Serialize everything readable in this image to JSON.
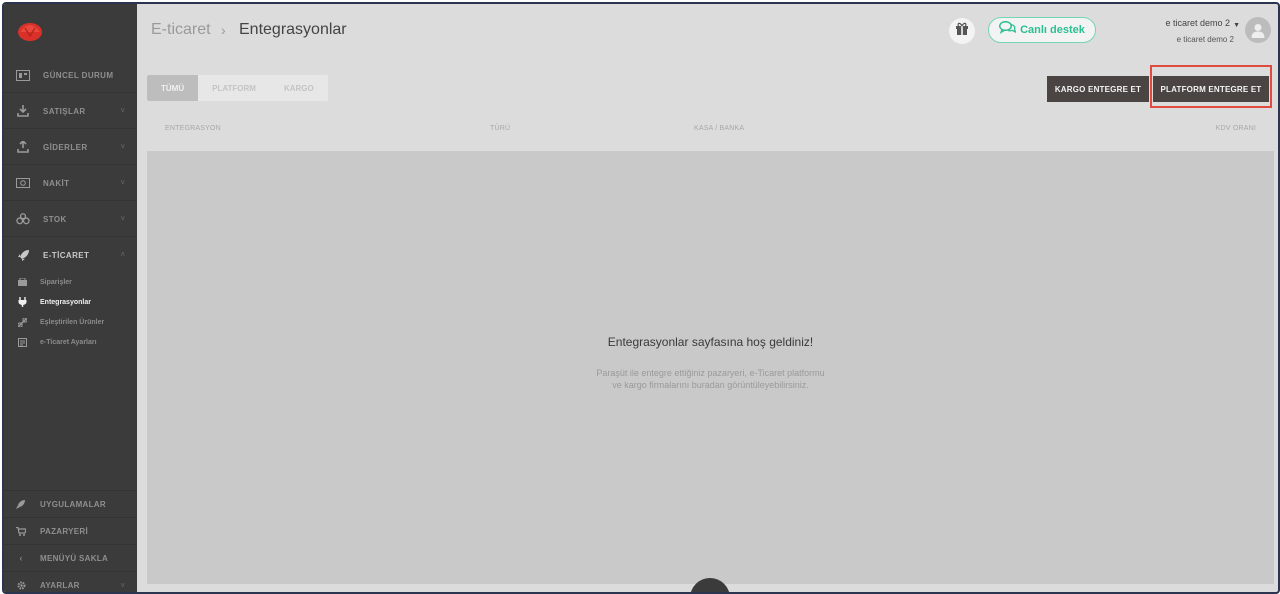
{
  "sidebar": {
    "items": [
      {
        "label": "GÜNCEL DURUM",
        "icon": "dashboard-icon"
      },
      {
        "label": "SATIŞLAR",
        "icon": "download-icon"
      },
      {
        "label": "GİDERLER",
        "icon": "upload-icon"
      },
      {
        "label": "NAKİT",
        "icon": "cash-icon"
      },
      {
        "label": "STOK",
        "icon": "boxes-icon"
      },
      {
        "label": "E-TİCARET",
        "icon": "rocket-icon"
      }
    ],
    "sub_items": [
      {
        "label": "Siparişler",
        "icon": "order-icon"
      },
      {
        "label": "Entegrasyonlar",
        "icon": "plug-icon"
      },
      {
        "label": "Eşleştirilen Ürünler",
        "icon": "link-icon"
      },
      {
        "label": "e-Ticaret Ayarları",
        "icon": "settings-list-icon"
      }
    ],
    "bottom_items": [
      {
        "label": "UYGULAMALAR",
        "icon": "apps-icon"
      },
      {
        "label": "PAZARYERİ",
        "icon": "cart-icon"
      },
      {
        "label": "MENÜYÜ SAKLA",
        "icon": "collapse-icon"
      },
      {
        "label": "AYARLAR",
        "icon": "gear-icon"
      }
    ]
  },
  "header": {
    "breadcrumb_root": "E-ticaret",
    "breadcrumb_sep": "›",
    "page_title": "Entegrasyonlar",
    "support_label": "Canlı destek",
    "user_name": "e ticaret demo 2",
    "user_company": "e ticaret demo 2"
  },
  "tabs": [
    "TÜMÜ",
    "PLATFORM",
    "KARGO"
  ],
  "actions": {
    "kargo": "KARGO ENTEGRE ET",
    "platform": "PLATFORM ENTEGRE ET"
  },
  "table": {
    "columns": [
      "ENTEGRASYON",
      "TÜRÜ",
      "KASA / BANKA",
      "KDV ORANI"
    ]
  },
  "empty_state": {
    "title": "Entegrasyonlar sayfasına hoş geldiniz!",
    "desc_line1": "Paraşüt ile entegre ettiğiniz pazaryeri, e-Ticaret platformu",
    "desc_line2": "ve kargo firmalarını buradan görüntüleyebilirsiniz."
  },
  "colors": {
    "accent": "#2bbf93",
    "dark_button": "#4a4443",
    "highlight": "#e04a3f"
  }
}
